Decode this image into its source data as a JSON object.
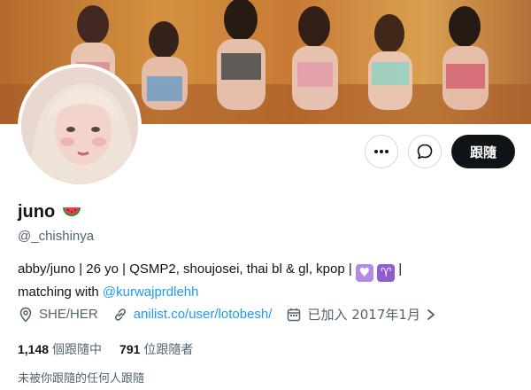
{
  "header": {
    "banner_description_icon": "group-photo-banner",
    "avatar_icon": "profile-avatar"
  },
  "actions": {
    "more_icon": "more-horizontal-icon",
    "message_icon": "message-bubble-icon",
    "follow_label": "跟隨"
  },
  "profile": {
    "name": "juno",
    "name_emoji": "🍉",
    "handle": "@_chishinya",
    "bio_line1": "abby/juno | 26 yo | QSMP2, shoujosei, thai bl & gl, kpop |",
    "bio_heart": "💜",
    "bio_aries": "♈",
    "bio_pipe": " |",
    "bio_line2_prefix": "matching with ",
    "bio_mention": "@kurwajprdlehh"
  },
  "meta": {
    "pronouns": "SHE/HER",
    "link": "anilist.co/user/lotobesh/",
    "joined": "已加入 2017年1月"
  },
  "stats": {
    "following_count": "1,148",
    "following_label": "個跟隨中",
    "followers_count": "791",
    "followers_label": "位跟隨者"
  },
  "note": "未被你跟隨的任何人跟隨",
  "colors": {
    "accent": "#1d9bf0",
    "text": "#0f1419",
    "secondary": "#536471",
    "border": "#cfd9de",
    "purple": "#9b6bd8"
  }
}
